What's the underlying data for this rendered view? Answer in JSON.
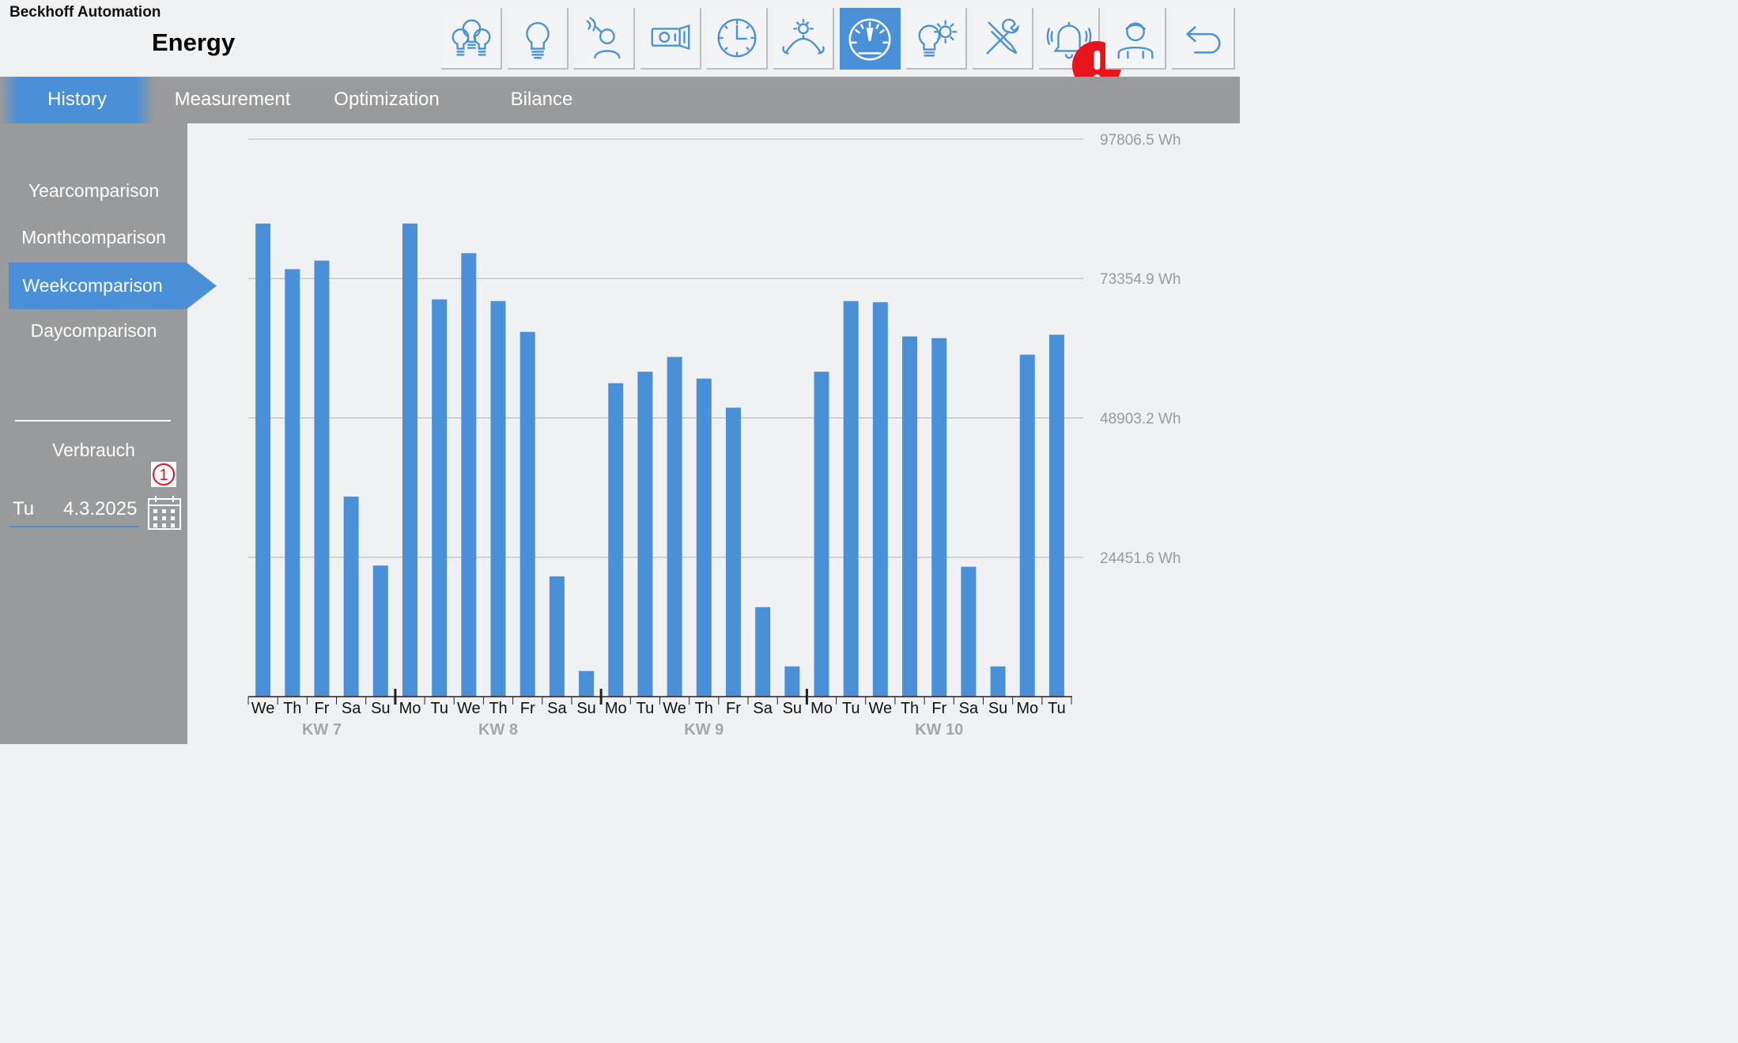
{
  "header": {
    "brand": "Beckhoff Automation",
    "title": "Energy",
    "toolbar": [
      {
        "icon": "lightbulbs-group-icon",
        "active": false
      },
      {
        "icon": "lightbulb-icon",
        "active": false
      },
      {
        "icon": "person-sensor-icon",
        "active": false
      },
      {
        "icon": "projector-blinds-icon",
        "active": false
      },
      {
        "icon": "clock-icon",
        "active": false
      },
      {
        "icon": "day-night-icon",
        "active": false
      },
      {
        "icon": "speedometer-icon",
        "active": true
      },
      {
        "icon": "bulb-gear-icon",
        "active": false
      },
      {
        "icon": "tools-icon",
        "active": false
      },
      {
        "icon": "alarm-bell-icon",
        "active": false,
        "badge": "!"
      },
      {
        "icon": "user-icon",
        "active": false
      },
      {
        "icon": "back-arrow-icon",
        "active": false
      }
    ]
  },
  "tabs": [
    {
      "label": "History",
      "active": true
    },
    {
      "label": "Measurement",
      "active": false
    },
    {
      "label": "Optimization",
      "active": false
    },
    {
      "label": "Bilance",
      "active": false
    }
  ],
  "sidebar": {
    "items": [
      {
        "label": "Yearcomparison",
        "active": false
      },
      {
        "label": "Monthcomparison",
        "active": false
      },
      {
        "label": "Weekcomparison",
        "active": true
      },
      {
        "label": "Daycomparison",
        "active": false
      }
    ],
    "verbrauch_label": "Verbrauch",
    "marker": "1",
    "date_day": "Tu",
    "date_value": "4.3.2025"
  },
  "colors": {
    "accent": "#4a90d9",
    "bar": "#4a90d9",
    "panel": "#999a9b",
    "background": "#f0f1f3",
    "alert": "#e8141b"
  },
  "chart_data": {
    "type": "bar",
    "ylim": [
      0,
      97806.5
    ],
    "yticks": [
      {
        "value": 97806.5,
        "label": "97806.5 Wh"
      },
      {
        "value": 73354.9,
        "label": "73354.9 Wh"
      },
      {
        "value": 48903.2,
        "label": "48903.2 Wh"
      },
      {
        "value": 24451.6,
        "label": "24451.6 Wh"
      }
    ],
    "grid": true,
    "categories": [
      "We",
      "Th",
      "Fr",
      "Sa",
      "Su",
      "Mo",
      "Tu",
      "We",
      "Th",
      "Fr",
      "Sa",
      "Su",
      "Mo",
      "Tu",
      "We",
      "Th",
      "Fr",
      "Sa",
      "Su",
      "Mo",
      "Tu",
      "We",
      "Th",
      "Fr",
      "Sa",
      "Su",
      "Mo",
      "Tu"
    ],
    "values": [
      83000,
      75000,
      76500,
      35100,
      23000,
      83000,
      69700,
      77800,
      69400,
      64000,
      21100,
      4500,
      55000,
      57000,
      59600,
      55800,
      50700,
      15700,
      5300,
      57000,
      69400,
      69200,
      63200,
      62900,
      22800,
      5300,
      60000,
      63500
    ],
    "weeks": [
      {
        "label": "KW 7",
        "start": 0,
        "end": 4
      },
      {
        "label": "KW 8",
        "start": 5,
        "end": 11
      },
      {
        "label": "KW 9",
        "start": 12,
        "end": 18
      },
      {
        "label": "KW 10",
        "start": 19,
        "end": 27
      }
    ]
  }
}
